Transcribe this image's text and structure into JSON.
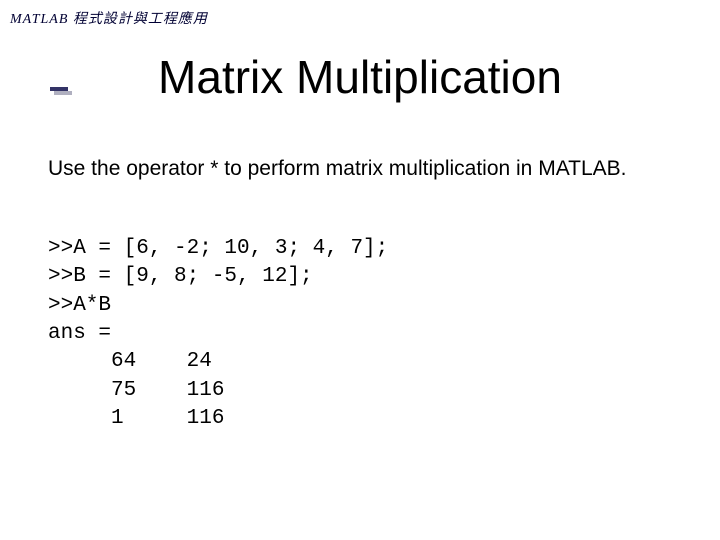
{
  "header": {
    "label": "MATLAB 程式設計與工程應用"
  },
  "title": "Matrix Multiplication",
  "body": "Use the operator * to perform matrix multiplication in MATLAB.",
  "code": ">>A = [6, -2; 10, 3; 4, 7];\n>>B = [9, 8; -5, 12];\n>>A*B\nans =\n     64    24\n     75    116\n     1     116"
}
